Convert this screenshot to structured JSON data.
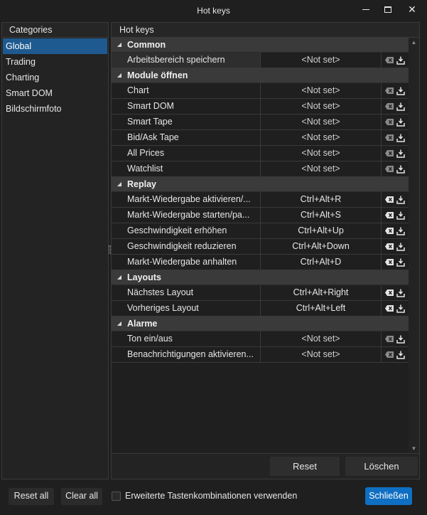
{
  "window": {
    "title": "Hot keys",
    "controls": {
      "minimize_icon": "minimize-icon",
      "maximize_icon": "maximize-icon",
      "close_symbol": "✕"
    }
  },
  "categories": {
    "header": "Categories",
    "items": [
      {
        "label": "Global",
        "selected": true
      },
      {
        "label": "Trading",
        "selected": false
      },
      {
        "label": "Charting",
        "selected": false
      },
      {
        "label": "Smart DOM",
        "selected": false
      },
      {
        "label": "Bildschirmfoto",
        "selected": false
      }
    ]
  },
  "hotkeys": {
    "header": "Hot keys",
    "groups": [
      {
        "title": "Common",
        "rows": [
          {
            "name": "Arbeitsbereich speichern",
            "key": "<Not set>",
            "set": false,
            "selected": true
          }
        ]
      },
      {
        "title": "Module öffnen",
        "rows": [
          {
            "name": "Chart",
            "key": "<Not set>",
            "set": false
          },
          {
            "name": "Smart DOM",
            "key": "<Not set>",
            "set": false
          },
          {
            "name": "Smart Tape",
            "key": "<Not set>",
            "set": false
          },
          {
            "name": "Bid/Ask Tape",
            "key": "<Not set>",
            "set": false
          },
          {
            "name": "All Prices",
            "key": "<Not set>",
            "set": false
          },
          {
            "name": "Watchlist",
            "key": "<Not set>",
            "set": false
          }
        ]
      },
      {
        "title": "Replay",
        "rows": [
          {
            "name": "Markt-Wiedergabe aktivieren/...",
            "key": "Ctrl+Alt+R",
            "set": true
          },
          {
            "name": "Markt-Wiedergabe starten/pa...",
            "key": "Ctrl+Alt+S",
            "set": true
          },
          {
            "name": "Geschwindigkeit erhöhen",
            "key": "Ctrl+Alt+Up",
            "set": true
          },
          {
            "name": "Geschwindigkeit reduzieren",
            "key": "Ctrl+Alt+Down",
            "set": true
          },
          {
            "name": "Markt-Wiedergabe anhalten",
            "key": "Ctrl+Alt+D",
            "set": true
          }
        ]
      },
      {
        "title": "Layouts",
        "rows": [
          {
            "name": "Nächstes Layout",
            "key": "Ctrl+Alt+Right",
            "set": true
          },
          {
            "name": "Vorheriges Layout",
            "key": "Ctrl+Alt+Left",
            "set": true
          }
        ]
      },
      {
        "title": "Alarme",
        "rows": [
          {
            "name": "Ton ein/aus",
            "key": "<Not set>",
            "set": false
          },
          {
            "name": "Benachrichtigungen aktivieren...",
            "key": "<Not set>",
            "set": false
          }
        ]
      }
    ],
    "footer": {
      "reset_label": "Reset",
      "delete_label": "Löschen"
    }
  },
  "bottom": {
    "reset_all_label": "Reset all",
    "clear_all_label": "Clear all",
    "checkbox_label": "Erweiterte Tastenkombinationen verwenden",
    "checkbox_checked": false,
    "close_label": "Schließen"
  },
  "colors": {
    "background": "#1f1f1f",
    "selection": "#1e5a8f",
    "primary_button": "#0f6fc2",
    "group_header": "#3a3a3a",
    "icon_active": "#e6e6e6",
    "icon_inactive": "#8a8a8a"
  }
}
